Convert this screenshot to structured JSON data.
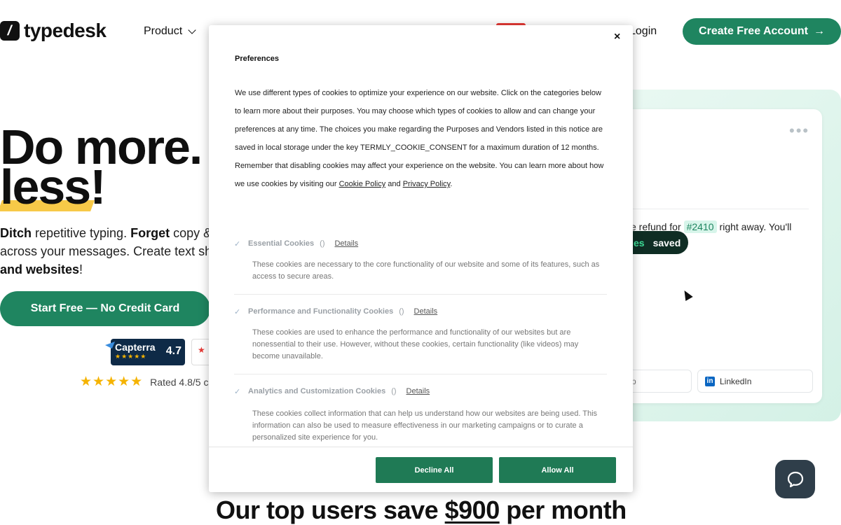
{
  "header": {
    "logo_glyph": "/",
    "logo_text": "typedesk",
    "nav_product": "Product",
    "nav_login": "Login",
    "cta_create": "Create Free Account",
    "cta_arrow": "→"
  },
  "hero": {
    "line1": "Do more.",
    "line2": "less!",
    "sub": {
      "p1_bold": "Ditch",
      "p1": " repetitive typing. ",
      "p2_bold": "Forget",
      "p2": " copy &",
      "line2": "across your messages. Create text sh",
      "line3_bold": "and websites",
      "line3": "!"
    },
    "cta_start": "Start Free — No Credit Card",
    "capterra": {
      "name": "Capterra",
      "stars": "★★★★★",
      "score": "4.7"
    },
    "g2_glyph": "★",
    "stars": "★★★★★",
    "rated_text": "Rated 4.8/5 c"
  },
  "mockup": {
    "dots": "•••",
    "text_pre": "e refund for",
    "tag": "#2410",
    "text_post": "right away. You'll",
    "pill_green": "es",
    "pill_text": "saved",
    "btn_a": "p",
    "btn_b_icon": "in",
    "btn_b": "LinkedIn"
  },
  "bottom": {
    "title_pre": "Our top users save ",
    "amount": "$900",
    "title_post": " per month"
  },
  "modal": {
    "close": "×",
    "title": "Preferences",
    "body_pre": "We use different types of cookies to optimize your experience on our website. Click on the categories below to learn more about their purposes. You may choose which types of cookies to allow and can change your preferences at any time. The choices you make regarding the Purposes and Vendors listed in this notice are saved in local storage under the key TERMLY_COOKIE_CONSENT for a maximum duration of 12 months. Remember that disabling cookies may affect your experience on the website. You can learn more about how we use cookies by visiting our ",
    "cookie_policy": "Cookie Policy",
    "and": " and ",
    "privacy_policy": "Privacy Policy",
    "period": ".",
    "check": "✓",
    "details_label": "Details",
    "categories": [
      {
        "title": "Essential Cookies",
        "count": "()",
        "desc": "These cookies are necessary to the core functionality of our website and some of its features, such as access to secure areas."
      },
      {
        "title": "Performance and Functionality Cookies",
        "count": "()",
        "desc": "These cookies are used to enhance the performance and functionality of our websites but are nonessential to their use. However, without these cookies, certain functionality (like videos) may become unavailable."
      },
      {
        "title": "Analytics and Customization Cookies",
        "count": "()",
        "desc": "These cookies collect information that can help us understand how our websites are being used. This information can also be used to measure effectiveness in our marketing campaigns or to curate a personalized site experience for you."
      }
    ],
    "decline": "Decline All",
    "allow": "Allow All"
  }
}
